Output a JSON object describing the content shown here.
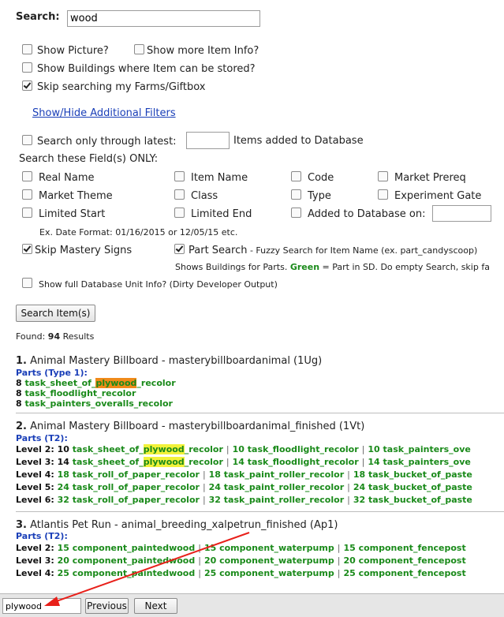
{
  "search": {
    "label": "Search:",
    "value": "wood"
  },
  "options": {
    "show_picture": {
      "label": "Show Picture?",
      "checked": false
    },
    "show_more_info": {
      "label": "Show more Item Info?",
      "checked": false
    },
    "show_buildings": {
      "label": "Show Buildings where Item can be stored?",
      "checked": false
    },
    "skip_farms": {
      "label": "Skip searching my Farms/Giftbox",
      "checked": true
    }
  },
  "filters_link": "Show/Hide Additional Filters",
  "latest": {
    "label": "Search only through latest:",
    "value": "",
    "suffix": "Items added to Database"
  },
  "fields_heading": "Search these Field(s) ONLY:",
  "fields": {
    "real_name": "Real Name",
    "item_name": "Item Name",
    "code": "Code",
    "market_prereq": "Market Prereq",
    "market_theme": "Market Theme",
    "class": "Class",
    "type": "Type",
    "experiment_gate": "Experiment Gate",
    "limited_start": "Limited Start",
    "limited_end": "Limited End",
    "added_db": "Added to Database on:"
  },
  "date_format": "Ex. Date Format: 01/16/2015 or 12/05/15 etc.",
  "skip_mastery": {
    "label": "Skip Mastery Signs",
    "checked": true
  },
  "part_search": {
    "label": "Part Search",
    "note": " - Fuzzy Search for Item Name (ex. part_candyscoop)",
    "checked": true,
    "line2_pre": "Shows Buildings for Parts. ",
    "line2_green": "Green",
    "line2_post": " = Part in SD. Do empty Search, skip fa"
  },
  "full_db": {
    "label": "Show full Database Unit Info? (Dirty Developer Output)",
    "checked": false
  },
  "search_button": "Search Item(s)",
  "found": {
    "prefix": "Found: ",
    "count": "94",
    "suffix": " Results"
  },
  "results": [
    {
      "num": "1.",
      "title": " Animal Mastery Billboard - masterybillboardanimal (1Ug)",
      "parts_label": "Parts (Type 1):",
      "lines": [
        {
          "qty": "8",
          "pre": "task_sheet_of_",
          "hl": "plywood",
          "post": "_recolor"
        },
        {
          "qty": "8",
          "text": "task_floodlight_recolor"
        },
        {
          "qty": "8",
          "text": "task_painters_overalls_recolor"
        }
      ]
    },
    {
      "num": "2.",
      "title": " Animal Mastery Billboard - masterybillboardanimal_finished (1Vt)",
      "parts_label": "Parts (T2):",
      "levels": [
        {
          "level": "Level 2:",
          "a_qty": "10",
          "a_pre": "task_sheet_of_",
          "a_hl": "plywood",
          "a_post": "_recolor",
          "b": "10 task_floodlight_recolor",
          "c": "10 task_painters_ove"
        },
        {
          "level": "Level 3:",
          "a_qty": "14",
          "a_pre": "task_sheet_of_",
          "a_hl": "plywood",
          "a_post": "_recolor",
          "b": "14 task_floodlight_recolor",
          "c": "14 task_painters_ove"
        },
        {
          "level": "Level 4:",
          "a": "18 task_roll_of_paper_recolor",
          "b": "18 task_paint_roller_recolor",
          "c": "18 task_bucket_of_paste"
        },
        {
          "level": "Level 5:",
          "a": "24 task_roll_of_paper_recolor",
          "b": "24 task_paint_roller_recolor",
          "c": "24 task_bucket_of_paste"
        },
        {
          "level": "Level 6:",
          "a": "32 task_roll_of_paper_recolor",
          "b": "32 task_paint_roller_recolor",
          "c": "32 task_bucket_of_paste"
        }
      ]
    },
    {
      "num": "3.",
      "title": " Atlantis Pet Run - animal_breeding_xalpetrun_finished (Ap1)",
      "parts_label": "Parts (T2):",
      "levels": [
        {
          "level": "Level 2:",
          "a": "15 component_paintedwood",
          "b": "15 component_waterpump",
          "c": "15 component_fencepost"
        },
        {
          "level": "Level 3:",
          "a": "20 component_paintedwood",
          "b": "20 component_waterpump",
          "c": "20 component_fencepost"
        },
        {
          "level": "Level 4:",
          "a": "25 component_paintedwood",
          "b": "25 component_waterpump",
          "c": "25 component_fencepost"
        }
      ]
    }
  ],
  "find_bar": {
    "value": "plywood",
    "previous": "Previous",
    "next": "Next"
  },
  "annotation_color": "#e8201a"
}
